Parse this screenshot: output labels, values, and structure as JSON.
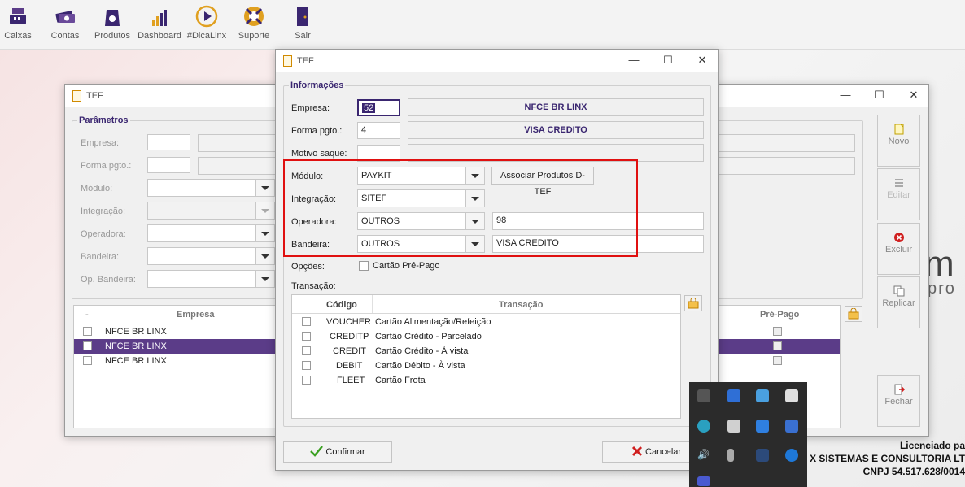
{
  "toolbar": {
    "items": [
      {
        "label": "Caixas",
        "icon": "cash-register-icon"
      },
      {
        "label": "Contas",
        "icon": "money-stack-icon"
      },
      {
        "label": "Produtos",
        "icon": "product-bag-icon"
      },
      {
        "label": "Dashboard",
        "icon": "bar-chart-icon"
      },
      {
        "label": "#DicaLinx",
        "icon": "play-circle-icon"
      },
      {
        "label": "Suporte",
        "icon": "lifebuoy-icon"
      },
      {
        "label": "Sair",
        "icon": "exit-door-icon"
      }
    ]
  },
  "colors": {
    "accent": "#3a2670",
    "selection": "#5b3c88",
    "highlight_box": "#e01010"
  },
  "back_window": {
    "title": "TEF",
    "group_title": "Parâmetros",
    "labels": {
      "empresa": "Empresa:",
      "forma": "Forma pgto.:",
      "modulo": "Módulo:",
      "integracao": "Integração:",
      "operadora": "Operadora:",
      "bandeira": "Bandeira:",
      "op_bandeira": "Op. Bandeira:"
    },
    "grid": {
      "col_check": "-",
      "col_empresa": "Empresa",
      "col_prepago": "Pré-Pago",
      "rows": [
        "NFCE BR LINX",
        "NFCE BR LINX",
        "NFCE BR LINX"
      ]
    },
    "side_buttons": {
      "novo": "Novo",
      "editar": "Editar",
      "excluir": "Excluir",
      "replicar": "Replicar",
      "fechar": "Fechar"
    }
  },
  "dialog": {
    "title": "TEF",
    "group_title": "Informações",
    "empresa": {
      "label": "Empresa:",
      "code": "52",
      "name": "NFCE BR LINX"
    },
    "forma": {
      "label": "Forma pgto.:",
      "code": "4",
      "name": "VISA CREDITO"
    },
    "motivo": {
      "label": "Motivo saque:",
      "code": "",
      "name": ""
    },
    "modulo": {
      "label": "Módulo:",
      "value": "PAYKIT"
    },
    "associar_button": "Associar Produtos D-TEF",
    "integracao": {
      "label": "Integração:",
      "value": "SITEF"
    },
    "operadora": {
      "label": "Operadora:",
      "value": "OUTROS",
      "code": "98"
    },
    "bandeira": {
      "label": "Bandeira:",
      "value": "OUTROS",
      "name": "VISA CREDITO"
    },
    "opcoes": {
      "label": "Opções:",
      "checkbox_label": "Cartão Pré-Pago"
    },
    "transacao_label": "Transação:",
    "grid": {
      "col_codigo": "Código",
      "col_transacao": "Transação",
      "rows": [
        {
          "codigo": "VOUCHER",
          "transacao": "Cartão Alimentação/Refeição"
        },
        {
          "codigo": "CREDITP",
          "transacao": "Cartão Crédito - Parcelado"
        },
        {
          "codigo": "CREDIT",
          "transacao": "Cartão Crédito - À vista"
        },
        {
          "codigo": "DEBIT",
          "transacao": "Cartão Débito - À vista"
        },
        {
          "codigo": "FLEET",
          "transacao": "Cartão Frota"
        }
      ]
    },
    "confirm_button": "Confirmar",
    "cancel_button": "Cancelar"
  },
  "brand": {
    "mark": "m",
    "sub": "pro"
  },
  "license": {
    "line1": "Licenciado pa",
    "line2": "X SISTEMAS E CONSULTORIA LT",
    "line3": "CNPJ 54.517.628/0014"
  }
}
